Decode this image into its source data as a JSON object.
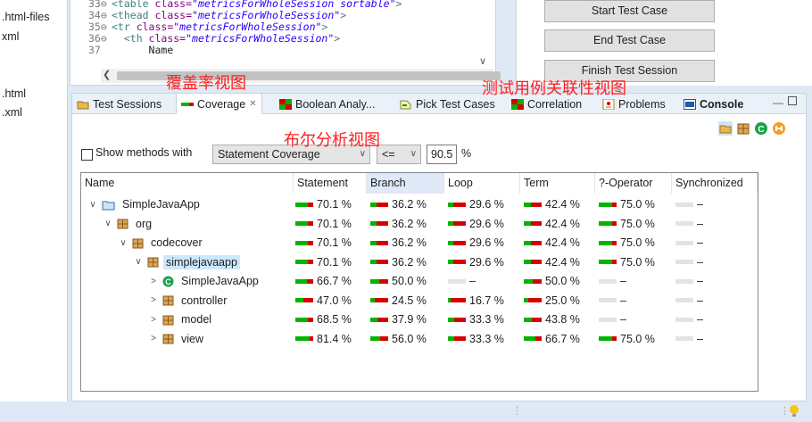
{
  "left_panel": {
    "files": [
      ".html-files",
      "xml",
      ".html",
      ".xml"
    ]
  },
  "editor": {
    "lines": [
      {
        "num": "33⊖",
        "parts": [
          {
            "t": "<table ",
            "c": "kw"
          },
          {
            "t": "class=",
            "c": "attr"
          },
          {
            "t": "\"metricsForWholeSession sortable\"",
            "c": "str"
          },
          {
            "t": ">",
            "c": "kw"
          }
        ]
      },
      {
        "num": "34⊖",
        "parts": [
          {
            "t": "<thead ",
            "c": "kw"
          },
          {
            "t": "class=",
            "c": "attr"
          },
          {
            "t": "\"metricsForWholeSession\"",
            "c": "str"
          },
          {
            "t": ">",
            "c": "kw"
          }
        ]
      },
      {
        "num": "35⊖",
        "parts": [
          {
            "t": "<tr ",
            "c": "kw"
          },
          {
            "t": "class=",
            "c": "attr"
          },
          {
            "t": "\"metricsForWholeSession\"",
            "c": "str"
          },
          {
            "t": ">",
            "c": "kw"
          }
        ]
      },
      {
        "num": "36⊖",
        "parts": [
          {
            "t": "  <th ",
            "c": "kw"
          },
          {
            "t": "class=",
            "c": "attr"
          },
          {
            "t": "\"metricsForWholeSession\"",
            "c": "str"
          },
          {
            "t": ">",
            "c": "kw"
          }
        ]
      },
      {
        "num": "37",
        "parts": [
          {
            "t": "      Name",
            "c": "txt"
          }
        ]
      }
    ]
  },
  "buttons": {
    "start": "Start Test Case",
    "end": "End Test Case",
    "finish": "Finish Test Session"
  },
  "annotations": {
    "coverage_view": "覆盖率视图",
    "correlation_view": "测试用例关联性视图",
    "boolean_view": "布尔分析视图"
  },
  "tabs": [
    {
      "label": "Test Sessions",
      "icon": "test-sessions-icon"
    },
    {
      "label": "Coverage",
      "icon": "coverage-icon",
      "close": "✕"
    },
    {
      "label": "Boolean Analy...",
      "icon": "boolean-analyzer-icon"
    },
    {
      "label": "Pick Test Cases",
      "icon": "pick-test-cases-icon"
    },
    {
      "label": "Correlation",
      "icon": "correlation-icon"
    },
    {
      "label": "Problems",
      "icon": "problems-icon"
    },
    {
      "label": "Console",
      "icon": "console-icon"
    }
  ],
  "filter": {
    "checkbox_label": "Show methods with",
    "metric": "Statement Coverage",
    "operator": "<=",
    "value": "90.5",
    "unit": "%"
  },
  "columns": [
    "Name",
    "Statement",
    "Branch",
    "Loop",
    "Term",
    "?-Operator",
    "Synchronized"
  ],
  "colors": {
    "covered": "#00b400",
    "uncovered": "#d70000",
    "none": "#e3e3e3"
  },
  "rows": [
    {
      "name": "SimpleJavaApp",
      "icon": "project-folder-icon",
      "expander": "∨",
      "level": 0,
      "statement": {
        "text": "70.1 %",
        "pct": 70.1
      },
      "branch": {
        "text": "36.2 %",
        "pct": 36.2
      },
      "loop": {
        "text": "29.6 %",
        "pct": 29.6
      },
      "term": {
        "text": "42.4 %",
        "pct": 42.4
      },
      "qop": {
        "text": "75.0 %",
        "pct": 75.0
      },
      "sync": {
        "text": "–",
        "pct": null
      }
    },
    {
      "name": "org",
      "icon": "package-icon",
      "expander": "∨",
      "level": 1,
      "statement": {
        "text": "70.1 %",
        "pct": 70.1
      },
      "branch": {
        "text": "36.2 %",
        "pct": 36.2
      },
      "loop": {
        "text": "29.6 %",
        "pct": 29.6
      },
      "term": {
        "text": "42.4 %",
        "pct": 42.4
      },
      "qop": {
        "text": "75.0 %",
        "pct": 75.0
      },
      "sync": {
        "text": "–",
        "pct": null
      }
    },
    {
      "name": "codecover",
      "icon": "package-icon",
      "expander": "∨",
      "level": 2,
      "statement": {
        "text": "70.1 %",
        "pct": 70.1
      },
      "branch": {
        "text": "36.2 %",
        "pct": 36.2
      },
      "loop": {
        "text": "29.6 %",
        "pct": 29.6
      },
      "term": {
        "text": "42.4 %",
        "pct": 42.4
      },
      "qop": {
        "text": "75.0 %",
        "pct": 75.0
      },
      "sync": {
        "text": "–",
        "pct": null
      }
    },
    {
      "name": "simplejavaapp",
      "icon": "package-icon",
      "expander": "∨",
      "level": 3,
      "selected": true,
      "statement": {
        "text": "70.1 %",
        "pct": 70.1
      },
      "branch": {
        "text": "36.2 %",
        "pct": 36.2
      },
      "loop": {
        "text": "29.6 %",
        "pct": 29.6
      },
      "term": {
        "text": "42.4 %",
        "pct": 42.4
      },
      "qop": {
        "text": "75.0 %",
        "pct": 75.0
      },
      "sync": {
        "text": "–",
        "pct": null
      }
    },
    {
      "name": "SimpleJavaApp",
      "icon": "class-icon",
      "expander": ">",
      "level": 4,
      "statement": {
        "text": "66.7 %",
        "pct": 66.7
      },
      "branch": {
        "text": "50.0 %",
        "pct": 50.0
      },
      "loop": {
        "text": "–",
        "pct": null
      },
      "term": {
        "text": "50.0 %",
        "pct": 50.0
      },
      "qop": {
        "text": "–",
        "pct": null
      },
      "sync": {
        "text": "–",
        "pct": null
      }
    },
    {
      "name": "controller",
      "icon": "package-icon",
      "expander": ">",
      "level": 4,
      "statement": {
        "text": "47.0 %",
        "pct": 47.0
      },
      "branch": {
        "text": "24.5 %",
        "pct": 24.5
      },
      "loop": {
        "text": "16.7 %",
        "pct": 16.7
      },
      "term": {
        "text": "25.0 %",
        "pct": 25.0
      },
      "qop": {
        "text": "–",
        "pct": null
      },
      "sync": {
        "text": "–",
        "pct": null
      }
    },
    {
      "name": "model",
      "icon": "package-icon",
      "expander": ">",
      "level": 4,
      "statement": {
        "text": "68.5 %",
        "pct": 68.5
      },
      "branch": {
        "text": "37.9 %",
        "pct": 37.9
      },
      "loop": {
        "text": "33.3 %",
        "pct": 33.3
      },
      "term": {
        "text": "43.8 %",
        "pct": 43.8
      },
      "qop": {
        "text": "–",
        "pct": null
      },
      "sync": {
        "text": "–",
        "pct": null
      }
    },
    {
      "name": "view",
      "icon": "package-icon",
      "expander": ">",
      "level": 4,
      "statement": {
        "text": "81.4 %",
        "pct": 81.4
      },
      "branch": {
        "text": "56.0 %",
        "pct": 56.0
      },
      "loop": {
        "text": "33.3 %",
        "pct": 33.3
      },
      "term": {
        "text": "66.7 %",
        "pct": 66.7
      },
      "qop": {
        "text": "75.0 %",
        "pct": 75.0
      },
      "sync": {
        "text": "–",
        "pct": null
      }
    }
  ]
}
